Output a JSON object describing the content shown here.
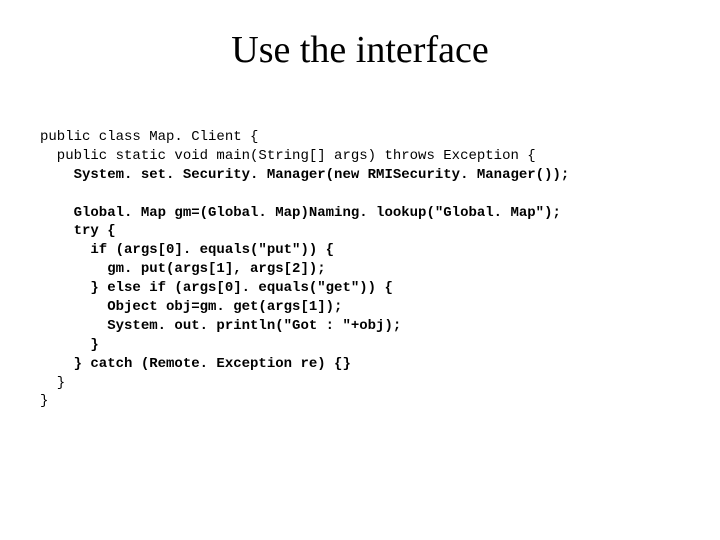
{
  "title": "Use the interface",
  "code": {
    "l1": "public class Map. Client {",
    "l2": "  public static void main(String[] args) throws Exception {",
    "l3": "    System. set. Security. Manager(new RMISecurity. Manager());",
    "l4": "",
    "l5": "    Global. Map gm=(Global. Map)Naming. lookup(\"Global. Map\");",
    "l6": "    try {",
    "l7": "      if (args[0]. equals(\"put\")) {",
    "l8": "        gm. put(args[1], args[2]);",
    "l9": "      } else if (args[0]. equals(\"get\")) {",
    "l10": "        Object obj=gm. get(args[1]);",
    "l11": "        System. out. println(\"Got : \"+obj);",
    "l12": "      }",
    "l13": "    } catch (Remote. Exception re) {}",
    "l14": "  }",
    "l15": "}"
  }
}
